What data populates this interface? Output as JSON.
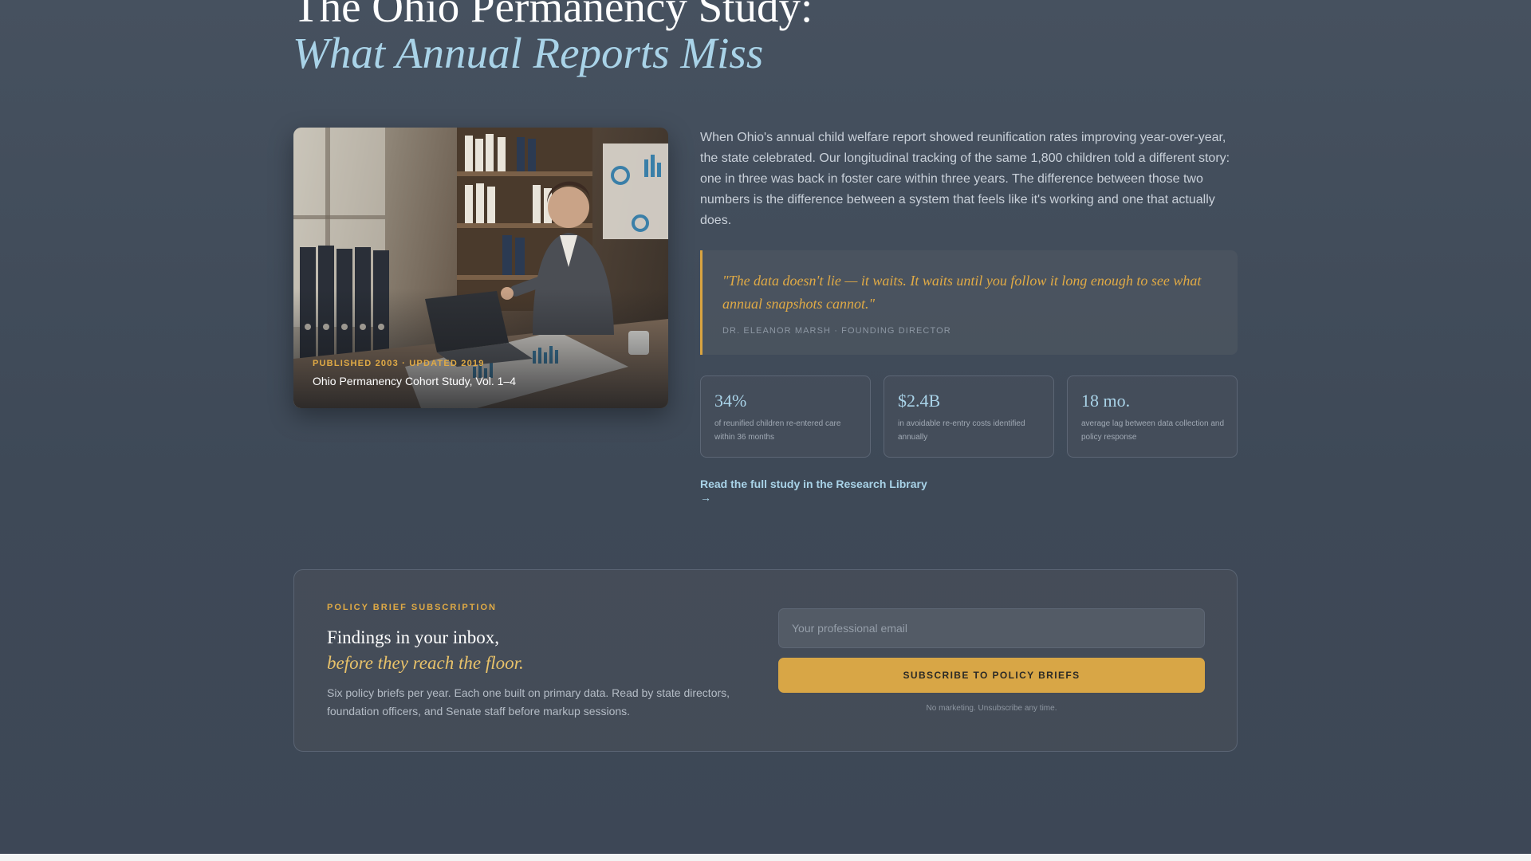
{
  "header": {
    "title_line1": "The Ohio Permanency Study:",
    "title_line2": "What Annual Reports Miss"
  },
  "featured_image": {
    "meta": "PUBLISHED 2003 · UPDATED 2019",
    "caption": "Ohio Permanency Cohort Study, Vol. 1–4"
  },
  "intro": {
    "text": "When Ohio's annual child welfare report showed reunification rates improving year-over-year, the state celebrated. Our longitudinal tracking of the same 1,800 children told a different story: one in three was back in foster care within three years. The difference between those two numbers is the difference between a system that feels like it's working and one that actually does."
  },
  "quote": {
    "text": "\"The data doesn't lie — it waits. It waits until you follow it long enough to see what annual snapshots cannot.\"",
    "attribution": "DR. ELEANOR MARSH · FOUNDING DIRECTOR"
  },
  "stats": [
    {
      "value": "34%",
      "label": "of reunified children re-entered care within 36 months"
    },
    {
      "value": "$2.4B",
      "label": "in avoidable re-entry costs identified annually"
    },
    {
      "value": "18 mo.",
      "label": "average lag between data collection and policy response"
    }
  ],
  "study_link": {
    "label": "Read the full study in the Research Library",
    "arrow": "→"
  },
  "subscription": {
    "eyebrow": "POLICY BRIEF SUBSCRIPTION",
    "heading": "Findings in your inbox,",
    "heading_italic": "before they reach the floor.",
    "description": "Six policy briefs per year. Each one built on primary data. Read by state directors, foundation officers, and Senate staff before markup sessions.",
    "email_placeholder": "Your professional email",
    "email_value": "",
    "button_label": "SUBSCRIBE TO POLICY BRIEFS",
    "note": "No marketing. Unsubscribe any time."
  },
  "colors": {
    "background": "#434e5c",
    "accent_gold": "#d8a646",
    "accent_blue": "#a9d3e8"
  }
}
